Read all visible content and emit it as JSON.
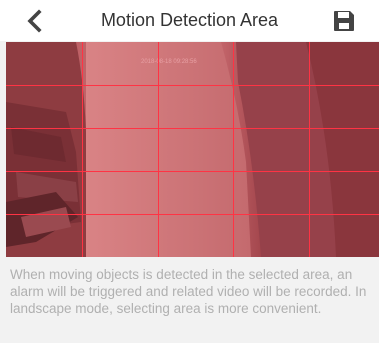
{
  "header": {
    "title": "Motion Detection Area",
    "back_icon": "chevron-left-icon",
    "save_icon": "floppy-disk-icon"
  },
  "colors": {
    "nav_background": "#ffffff",
    "page_background": "#f2f2f2",
    "grid_line": "#ff3344",
    "selection_tint": "#e02a3a",
    "hint_text": "#b0b0b0",
    "icon": "#444444"
  },
  "detection_grid": {
    "columns": 5,
    "rows": 5,
    "selected_cells": "all"
  },
  "hint": {
    "text": "When moving objects is detected in the selected area, an alarm will be triggered and related video will be recorded. In landscape mode, selecting area is more convenient."
  }
}
